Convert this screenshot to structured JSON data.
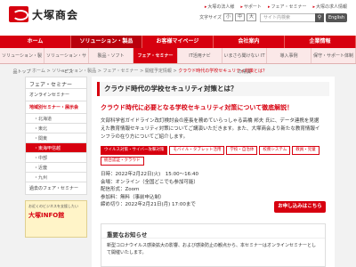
{
  "brand": {
    "name": "大塚商会"
  },
  "utility": [
    "大塚の法人様",
    "サポート",
    "フェア・セミナー",
    "大塚の求人情報"
  ],
  "fontsize": {
    "label": "文字サイズ",
    "small": "小",
    "medium": "中",
    "large": "大"
  },
  "search": {
    "placeholder": "サイト内検索",
    "button": "⚲"
  },
  "lang": "English",
  "mainnav": [
    "ホーム",
    "ソリューション・製品",
    "お客様マイページ",
    "会社案内",
    "企業情報"
  ],
  "subnav": [
    "ソリューション・製品トップ",
    "ソリューション・サービス",
    "製品・ソフト",
    "フェア・セミナー",
    "IT活用ナビ",
    "いまさら聞けない ITの常識",
    "導入事例",
    "保守・サポート体制"
  ],
  "breadcrumb": [
    "ホーム",
    "ソリューション・製品",
    "フェア・セミナー",
    "開催予定情報",
    "クラウド時代の学校セキュリティ対策とは？"
  ],
  "sidebar": {
    "heading": "フェア・セミナー",
    "items": [
      "オンラインセミナー",
      "地域別セミナー・展示会"
    ],
    "subitems": [
      "北海道",
      "東北",
      "関東",
      "東海甲信越",
      "中部",
      "近畿",
      "九州"
    ],
    "last": "過去のフェア・セミナー",
    "banner_top": "お近くのビジネスを支援したい",
    "banner_main": "大塚INFO館"
  },
  "main": {
    "title": "クラウド時代の学校セキュリティ対策とは？",
    "subtitle": "クラウド時代に必要となる学校セキュリティ対策について徹底解説！",
    "desc": "文部科学省ガイドライン改訂検討会の座長を務めていらっしゃる高橋 邦夫 氏に、データ連携を見据えた教育情報セキュリティ対策についてご講演いただきます。また、大塚商会より新たな教育情報インフラの在り方についてご紹介します。",
    "tags": [
      "ウイルス対策・サイバー攻撃対策",
      "モバイル・タブレット活用",
      "学校・自治体",
      "校務システム",
      "教員・児童",
      "統合認証・クラウド"
    ],
    "details": [
      "日時：2022年2月22日(火)　15:00～16:40",
      "会場：オンライン（全国どこでも参加可能）",
      "配信形式：Zoom",
      "参加料：無料（事前申込制）",
      "締め切り：2022年2月21日(月) 17:00まで"
    ],
    "apply": "お申し込みはこちら",
    "notice_title": "重要なお知らせ",
    "notice_body": "新型コロナウイルス感染拡大の影響、および感染防止の観点から、本セミナーはオンラインセミナーとして開催いたします。"
  }
}
